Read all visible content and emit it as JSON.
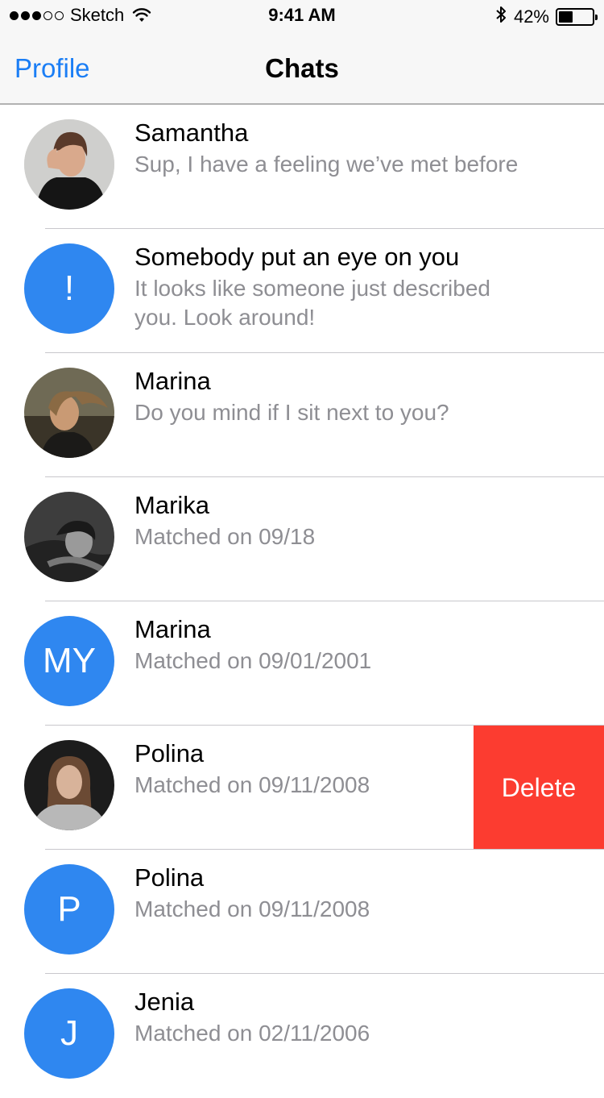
{
  "status_bar": {
    "carrier": "Sketch",
    "time": "9:41 AM",
    "battery_percent": "42%",
    "battery_level": 0.42,
    "signal_icon": "signal-dots-icon",
    "wifi_icon": "wifi-icon",
    "bluetooth_icon": "bluetooth-icon"
  },
  "nav": {
    "left_label": "Profile",
    "title": "Chats",
    "accent_color": "#1b7ef5"
  },
  "chats": [
    {
      "name": "Samantha",
      "message": "Sup, I have a feeling we’ve met before",
      "avatar_type": "photo",
      "avatar_initials": ""
    },
    {
      "name": "Somebody put an eye on you",
      "message": "It looks like someone just described you. Look around!",
      "avatar_type": "initials",
      "avatar_initials": "!"
    },
    {
      "name": "Marina",
      "message": "Do you mind if I sit next to you?",
      "avatar_type": "photo",
      "avatar_initials": ""
    },
    {
      "name": "Marika",
      "message": "Matched on 09/18",
      "avatar_type": "photo",
      "avatar_initials": ""
    },
    {
      "name": "Marina",
      "message": "Matched on 09/01/2001",
      "avatar_type": "initials",
      "avatar_initials": "MY"
    },
    {
      "name": "Polina",
      "message": "Matched on 09/11/2008",
      "avatar_type": "photo",
      "avatar_initials": "",
      "delete_label": "Delete"
    },
    {
      "name": "Polina",
      "message": "Matched on 09/11/2008",
      "avatar_type": "initials",
      "avatar_initials": "P"
    },
    {
      "name": "Jenia",
      "message": "Matched on 02/11/2006",
      "avatar_type": "initials",
      "avatar_initials": "J"
    }
  ],
  "colors": {
    "avatar_blue": "#2f87f0",
    "delete_red": "#fc3c30",
    "secondary_text": "#8e8e93"
  }
}
